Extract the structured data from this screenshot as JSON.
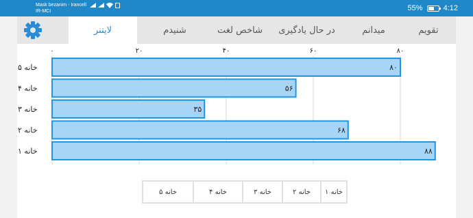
{
  "status_bar": {
    "carrier_line1": "Mask bezanim - Irancell",
    "carrier_line2": "IR-MCI",
    "battery_percent": "55%",
    "battery_level": 0.55,
    "time": "4:12"
  },
  "tabs": [
    {
      "label": "تقویم",
      "active": false
    },
    {
      "label": "میدانم",
      "active": false
    },
    {
      "label": "در حال یادگیری",
      "active": false
    },
    {
      "label": "شاخص لغت",
      "active": false
    },
    {
      "label": "شنیدم",
      "active": false
    },
    {
      "label": "لایتنر",
      "active": true
    }
  ],
  "settings_icon": "gear-icon",
  "chart_data": {
    "type": "bar",
    "orientation": "horizontal",
    "categories": [
      "خانه ۵",
      "خانه ۴",
      "خانه ۳",
      "خانه ۲",
      "خانه ۱"
    ],
    "values": [
      80,
      56,
      35,
      68,
      88
    ],
    "value_labels": [
      "۸۰",
      "۵۶",
      "۳۵",
      "۶۸",
      "۸۸"
    ],
    "x_ticks": [
      0,
      20,
      40,
      60,
      80
    ],
    "x_tick_labels": [
      "۰",
      "۲۰",
      "۴۰",
      "۶۰",
      "۸۰"
    ],
    "xlim": [
      0,
      88
    ],
    "grid": true,
    "axis_position": "top",
    "bar_fill": "#a6d5f7",
    "bar_stroke": "#1e96e6"
  },
  "legend_buttons": [
    "خانه ۱",
    "خانه ۲",
    "خانه ۳",
    "خانه ۴",
    "خانه ۵"
  ],
  "colors": {
    "accent": "#2a8bd6",
    "status_bar": "#1e88c8",
    "tab_bar": "#e6e6e6"
  }
}
